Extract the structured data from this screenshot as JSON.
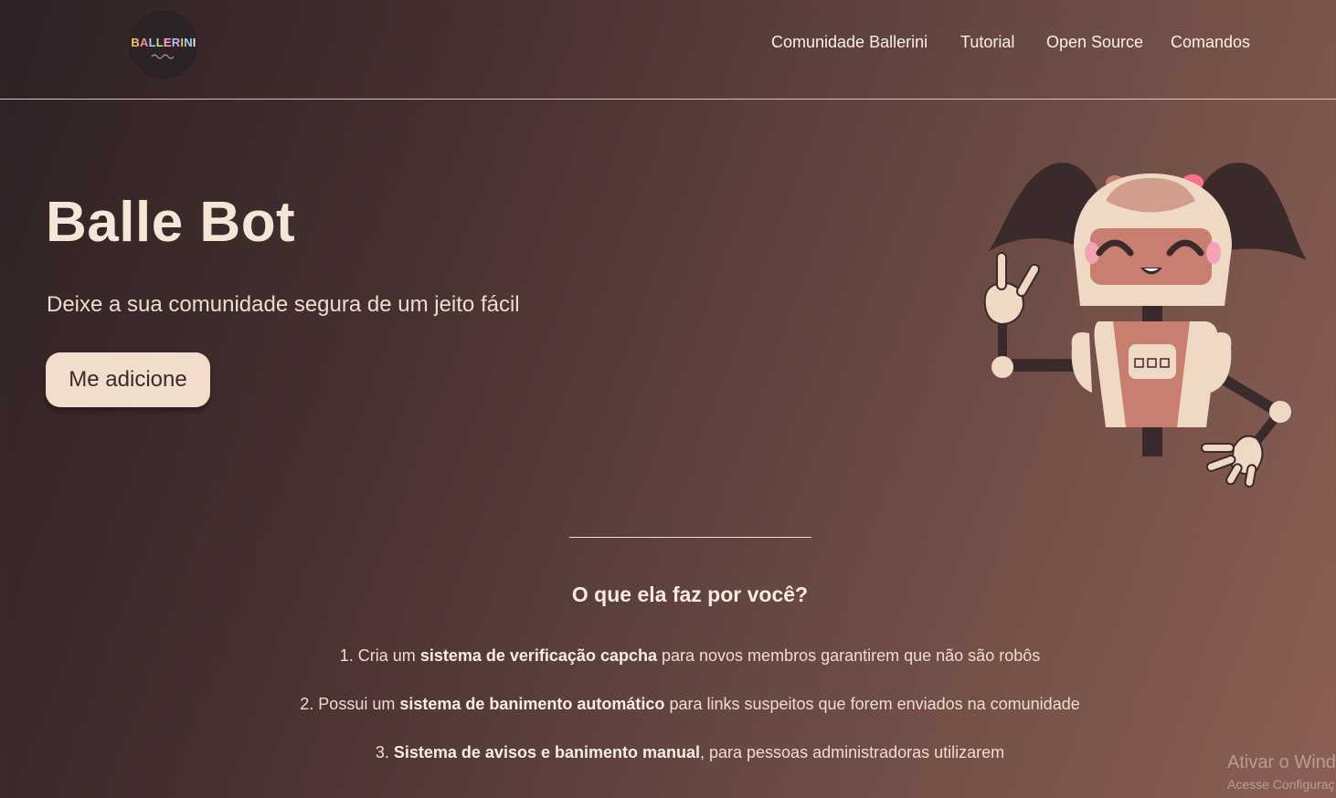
{
  "header": {
    "logo_text": "BALLERINI",
    "nav": [
      {
        "label": "Comunidade Ballerini"
      },
      {
        "label": "Tutorial"
      },
      {
        "label": "Open Source"
      },
      {
        "label": "Comandos"
      }
    ]
  },
  "hero": {
    "title": "Balle Bot",
    "subtitle": "Deixe a sua comunidade segura de um jeito fácil",
    "cta_label": "Me adicione"
  },
  "features": {
    "title": "O que ela faz por você?",
    "items": [
      {
        "num": "1.",
        "pre": "Cria um",
        "bold": "sistema de verificação capcha",
        "post": "para novos membros garantirem que não são robôs"
      },
      {
        "num": "2.",
        "pre": "Possui um",
        "bold": "sistema de banimento automático",
        "post": "para links suspeitos que forem enviados na comunidade"
      },
      {
        "num": "3.",
        "pre": "",
        "bold": "Sistema de avisos e banimento manual",
        "post": ", para pessoas administradoras utilizarem"
      }
    ]
  },
  "watermark": {
    "line1": "Ativar o Wind",
    "line2": "Acesse Configuraç"
  },
  "colors": {
    "accent_button": "#f2dccb",
    "robot_pink": "#c97f70",
    "robot_cream": "#efd8c4",
    "hair": "#3a2a2c"
  },
  "icons": [
    "ballerini-logo",
    "robot-mascot-illustration"
  ]
}
